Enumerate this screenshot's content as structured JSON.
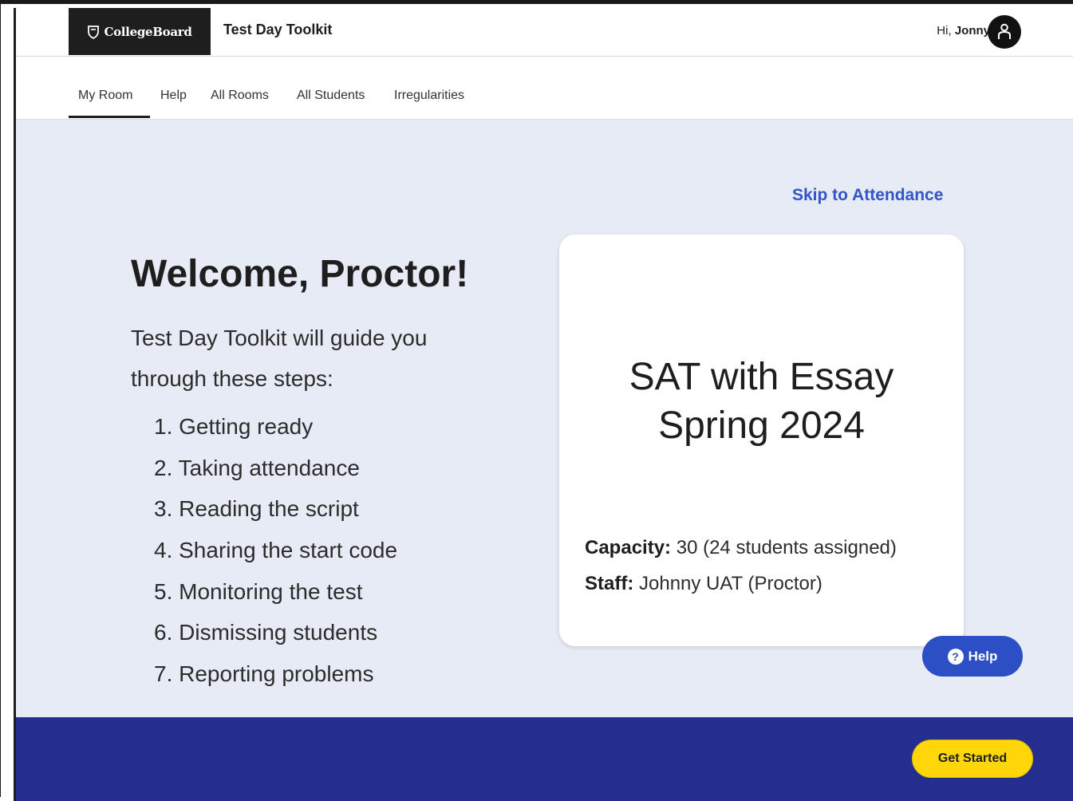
{
  "header": {
    "brand": "CollegeBoard",
    "app_title": "Test Day Toolkit",
    "greeting_prefix": "Hi,",
    "user_name": "Jonny"
  },
  "nav": {
    "items": [
      {
        "label": "My Room",
        "active": true
      },
      {
        "label": "Help",
        "active": false
      },
      {
        "label": "All Rooms",
        "active": false
      },
      {
        "label": "All Students",
        "active": false
      },
      {
        "label": "Irregularities",
        "active": false
      }
    ]
  },
  "main": {
    "skip_link": "Skip to Attendance",
    "welcome_title": "Welcome, Proctor!",
    "intro": "Test Day Toolkit will guide you through these steps:",
    "steps": [
      "1. Getting ready",
      "2. Taking attendance",
      "3. Reading the script",
      "4. Sharing the start code",
      "5. Monitoring the test",
      "6. Dismissing students",
      "7. Reporting problems"
    ],
    "card": {
      "test_name": "SAT with Essay",
      "term": "Spring 2024",
      "capacity_label": "Capacity:",
      "capacity_value": "30 (24 students assigned)",
      "staff_label": "Staff:",
      "staff_value": "Johnny UAT (Proctor)"
    },
    "help_button": "Help"
  },
  "footer": {
    "get_started": "Get Started"
  },
  "colors": {
    "main_bg": "#e6ebf5",
    "footer_bg": "#252e8e",
    "link_blue": "#3355c5",
    "help_blue": "#2c4fc6",
    "cta_yellow": "#ffd60a",
    "brand_bg": "#1e1e1e"
  },
  "icons": {
    "brand_logo": "acorn-shield-icon",
    "avatar": "user-icon",
    "help": "question-circle-icon"
  }
}
